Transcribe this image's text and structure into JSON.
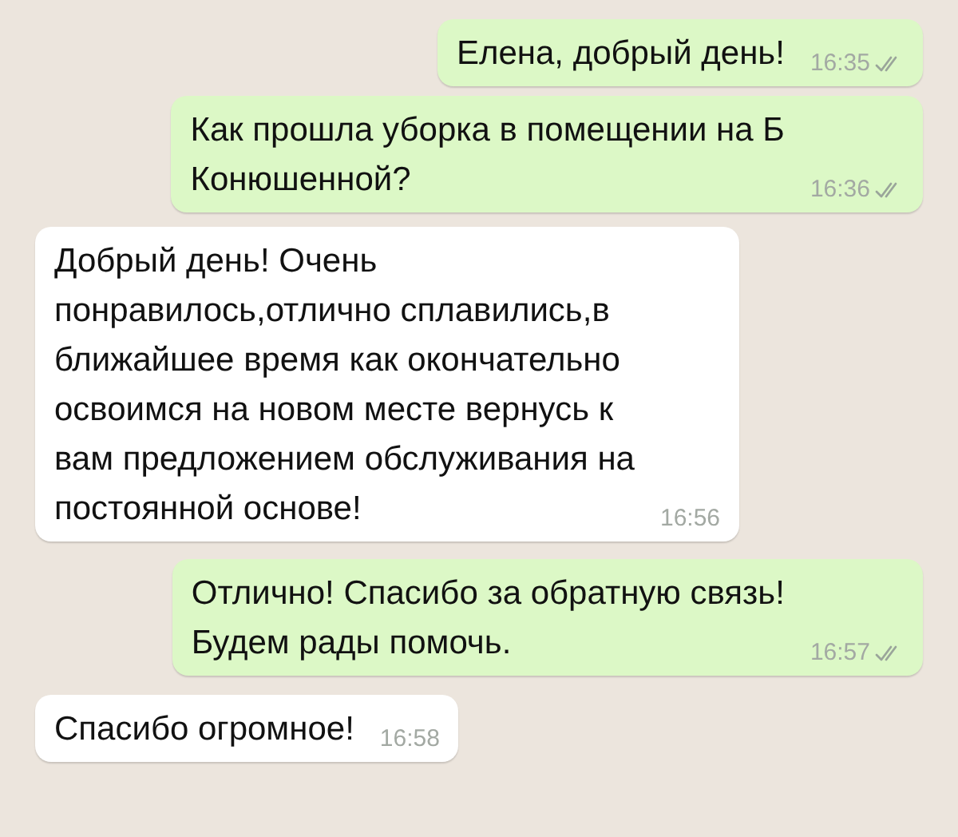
{
  "messages": [
    {
      "kind": "outgoing",
      "text": "Елена, добрый день!",
      "time": "16:35",
      "delivered": true
    },
    {
      "kind": "outgoing",
      "text": "Как прошла уборка в помещении на Б\nКонюшенной?",
      "time": "16:36",
      "delivered": true
    },
    {
      "kind": "incoming",
      "text": "Добрый день! Очень\nпонравилось,отлично сплавились,в\nближайшее время как окончательно\nосвоимся на новом месте вернусь к\nвам предложением обслуживания на\nпостоянной основе!",
      "time": "16:56"
    },
    {
      "kind": "outgoing",
      "text": "Отлично! Спасибо за обратную связь!\nБудем рады помочь.",
      "time": "16:57",
      "delivered": true
    },
    {
      "kind": "incoming",
      "text": "Спасибо огромное!",
      "time": "16:58"
    }
  ]
}
